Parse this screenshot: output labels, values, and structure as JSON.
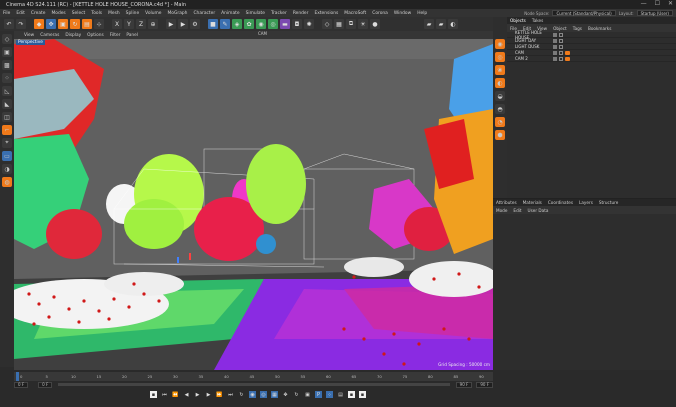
{
  "window": {
    "title": "Cinema 4D S24.111 (RC) - [KETTLE HOLE HOUSE_CORONA.c4d *] - Main",
    "controls": [
      "—",
      "☐",
      "✕"
    ]
  },
  "menu": [
    "File",
    "Edit",
    "Create",
    "Modes",
    "Select",
    "Tools",
    "Mesh",
    "Spline",
    "Volume",
    "MoGraph",
    "Character",
    "Animate",
    "Simulate",
    "Tracker",
    "Render",
    "Extensions",
    "MacroSoft",
    "Corona",
    "Window",
    "Help"
  ],
  "node_space": {
    "label": "Node Space:",
    "value": "Current (Standard/Physical)",
    "layout_label": "Layout:",
    "layout_value": "Startup (User)"
  },
  "viewport": {
    "menu": [
      "View",
      "Cameras",
      "Display",
      "Options",
      "Filter",
      "Panel"
    ],
    "camera_label": "CAM",
    "label": "Perspective",
    "grid_spacing": "Grid Spacing : 50000 cm"
  },
  "objects_panel": {
    "tabs": [
      "Objects",
      "Takes"
    ],
    "menu": [
      "File",
      "Edit",
      "View",
      "Object",
      "Tags",
      "Bookmarks"
    ],
    "items": [
      {
        "name": "KETTLE HOLE HOUSE",
        "color": "#7a7a7a"
      },
      {
        "name": "LIGHT DAY",
        "color": "#7a7a7a"
      },
      {
        "name": "LIGHT DUSK",
        "color": "#7a7a7a"
      },
      {
        "name": "CAM",
        "color": "#7a7a7a"
      },
      {
        "name": "CAM 2",
        "color": "#7a7a7a"
      }
    ]
  },
  "attributes_panel": {
    "tabs": [
      "Attributes",
      "Materials",
      "Coordinates",
      "Layers",
      "Structure"
    ],
    "menu": [
      "Mode",
      "Edit",
      "User Data"
    ]
  },
  "timeline": {
    "ticks": [
      "0",
      "5",
      "10",
      "15",
      "20",
      "25",
      "30",
      "35",
      "40",
      "45",
      "50",
      "55",
      "60",
      "65",
      "70",
      "75",
      "80",
      "85",
      "90"
    ],
    "current_frame": "0 F",
    "start_frame": "0 F",
    "end_field": "90 F",
    "end_field2": "90 F"
  },
  "colors": {
    "accent": "#f07a1a",
    "active_blue": "#3a6fb0"
  }
}
